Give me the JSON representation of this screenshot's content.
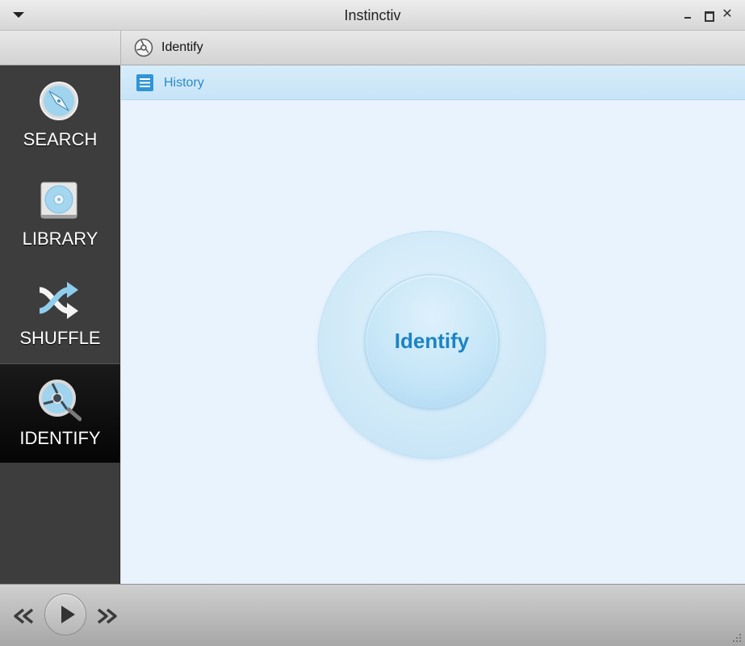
{
  "window": {
    "title": "Instinctiv",
    "close_glyph": "✕"
  },
  "breadcrumb": {
    "label": "Identify",
    "icon": "identify-disc-icon"
  },
  "sidebar": {
    "items": [
      {
        "label": "SEARCH",
        "icon": "compass-icon",
        "active": false
      },
      {
        "label": "LIBRARY",
        "icon": "cd-icon",
        "active": false
      },
      {
        "label": "SHUFFLE",
        "icon": "shuffle-icon",
        "active": false
      },
      {
        "label": "IDENTIFY",
        "icon": "identify-disc-icon",
        "active": true
      }
    ]
  },
  "content": {
    "history_label": "History",
    "identify_button_label": "Identify"
  },
  "colors": {
    "accent": "#1b83c4",
    "content_bg": "#e9f3fd",
    "sidebar_bg": "#3d3d3d"
  }
}
